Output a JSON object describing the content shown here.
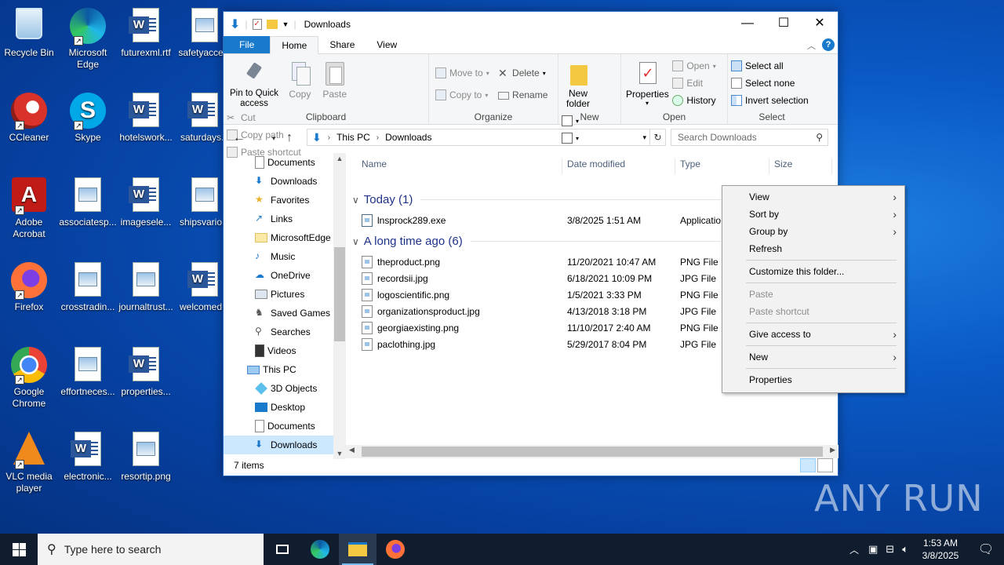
{
  "desktop": {
    "icons": [
      {
        "label": "Recycle Bin"
      },
      {
        "label": "Microsoft Edge"
      },
      {
        "label": "futurexml.rtf"
      },
      {
        "label": "safetyacce..."
      },
      {
        "label": "CCleaner"
      },
      {
        "label": "Skype"
      },
      {
        "label": "hotelswork..."
      },
      {
        "label": "saturdays..."
      },
      {
        "label": "Adobe Acrobat"
      },
      {
        "label": "associatesp..."
      },
      {
        "label": "imagesele..."
      },
      {
        "label": "shipsvario..."
      },
      {
        "label": "Firefox"
      },
      {
        "label": "crosstradin..."
      },
      {
        "label": "journaltrust..."
      },
      {
        "label": "welcomed..."
      },
      {
        "label": "Google Chrome"
      },
      {
        "label": "effortneces..."
      },
      {
        "label": "properties..."
      },
      {
        "label": "VLC media player"
      },
      {
        "label": "electronic..."
      },
      {
        "label": "resortip.png"
      }
    ]
  },
  "window": {
    "title": "Downloads",
    "tabs": [
      "File",
      "Home",
      "Share",
      "View"
    ],
    "ribbon": {
      "clipboard": {
        "name": "Clipboard",
        "pin": "Pin to Quick access",
        "copy": "Copy",
        "paste": "Paste",
        "cut": "Cut",
        "copy_path": "Copy path",
        "paste_shortcut": "Paste shortcut"
      },
      "organize": {
        "name": "Organize",
        "move_to": "Move to",
        "copy_to": "Copy to",
        "delete": "Delete",
        "rename": "Rename"
      },
      "new": {
        "name": "New",
        "new_folder": "New folder"
      },
      "open": {
        "name": "Open",
        "properties": "Properties",
        "open": "Open",
        "edit": "Edit",
        "history": "History"
      },
      "select": {
        "name": "Select",
        "select_all": "Select all",
        "select_none": "Select none",
        "invert": "Invert selection"
      }
    },
    "address": {
      "parts": [
        "This PC",
        "Downloads"
      ]
    },
    "search_placeholder": "Search Downloads",
    "nav": [
      {
        "label": "Documents"
      },
      {
        "label": "Downloads"
      },
      {
        "label": "Favorites"
      },
      {
        "label": "Links"
      },
      {
        "label": "MicrosoftEdge"
      },
      {
        "label": "Music"
      },
      {
        "label": "OneDrive"
      },
      {
        "label": "Pictures"
      },
      {
        "label": "Saved Games"
      },
      {
        "label": "Searches"
      },
      {
        "label": "Videos"
      },
      {
        "label": "This PC"
      },
      {
        "label": "3D Objects"
      },
      {
        "label": "Desktop"
      },
      {
        "label": "Documents"
      },
      {
        "label": "Downloads"
      }
    ],
    "columns": {
      "name": "Name",
      "date": "Date modified",
      "type": "Type",
      "size": "Size"
    },
    "groups": [
      {
        "title": "Today (1)",
        "files": [
          {
            "name": "lnsprock289.exe",
            "date": "3/8/2025 1:51 AM",
            "type": "Applicatio"
          }
        ]
      },
      {
        "title": "A long time ago (6)",
        "files": [
          {
            "name": "theproduct.png",
            "date": "11/20/2021 10:47 AM",
            "type": "PNG File"
          },
          {
            "name": "recordsii.jpg",
            "date": "6/18/2021 10:09 PM",
            "type": "JPG File"
          },
          {
            "name": "logoscientific.png",
            "date": "1/5/2021 3:33 PM",
            "type": "PNG File"
          },
          {
            "name": "organizationsproduct.jpg",
            "date": "4/13/2018 3:18 PM",
            "type": "JPG File"
          },
          {
            "name": "georgiaexisting.png",
            "date": "11/10/2017 2:40 AM",
            "type": "PNG File"
          },
          {
            "name": "paclothing.jpg",
            "date": "5/29/2017 8:04 PM",
            "type": "JPG File"
          }
        ]
      }
    ],
    "status": "7 items"
  },
  "context_menu": {
    "view": "View",
    "sort_by": "Sort by",
    "group_by": "Group by",
    "refresh": "Refresh",
    "customize": "Customize this folder...",
    "paste": "Paste",
    "paste_shortcut": "Paste shortcut",
    "give_access": "Give access to",
    "new": "New",
    "properties": "Properties"
  },
  "taskbar": {
    "search_placeholder": "Type here to search",
    "time": "1:53 AM",
    "date": "3/8/2025"
  },
  "watermark": "ANY RUN",
  "colors": {
    "accent": "#1979ca",
    "selection": "#cce8ff",
    "taskbar": "#101d2e"
  }
}
